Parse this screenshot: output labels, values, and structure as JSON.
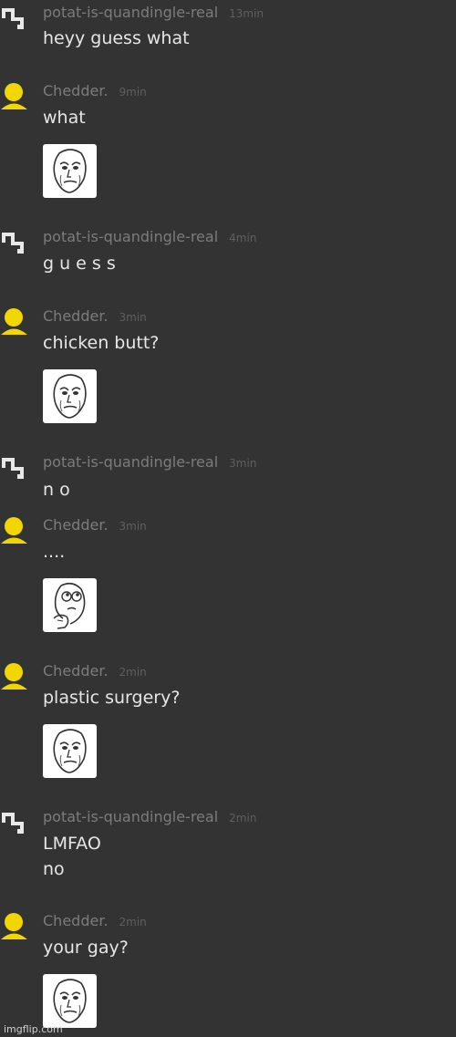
{
  "app": {
    "watermark": "imgflip.com"
  },
  "colors": {
    "background": "#333333",
    "username": "#7c7c7c",
    "timestamp": "#5f5f5f",
    "message": "#e6e6e6",
    "chedder_avatar": "#f2d600",
    "potat_avatar": "#e8e8e8"
  },
  "users": {
    "potat": {
      "name": "potat-is-quandingle-real",
      "avatar_icon": "square-spiral-icon"
    },
    "chedder": {
      "name": "Chedder.",
      "avatar_icon": "yellow-user-icon"
    }
  },
  "messages": [
    {
      "user": "potat-is-quandingle-real",
      "time": "13min",
      "lines": [
        "heyy guess what"
      ]
    },
    {
      "user": "Chedder.",
      "time": "9min",
      "lines": [
        "what"
      ],
      "sticker": "okay-guy-face-sticker"
    },
    {
      "user": "potat-is-quandingle-real",
      "time": "4min",
      "lines": [
        "g u e s s"
      ]
    },
    {
      "user": "Chedder.",
      "time": "3min",
      "lines": [
        "chicken butt?"
      ],
      "sticker": "okay-guy-face-sticker"
    },
    {
      "user": "potat-is-quandingle-real",
      "time": "3min",
      "lines": [
        "n o"
      ]
    },
    {
      "user": "Chedder.",
      "time": "3min",
      "lines": [
        "...."
      ],
      "sticker": "thinking-face-sticker"
    },
    {
      "user": "Chedder.",
      "time": "2min",
      "lines": [
        "plastic surgery?"
      ],
      "sticker": "okay-guy-face-sticker"
    },
    {
      "user": "potat-is-quandingle-real",
      "time": "2min",
      "lines": [
        "LMFAO",
        "no"
      ]
    },
    {
      "user": "Chedder.",
      "time": "2min",
      "lines": [
        "your gay?"
      ],
      "sticker": "okay-guy-face-sticker"
    }
  ]
}
